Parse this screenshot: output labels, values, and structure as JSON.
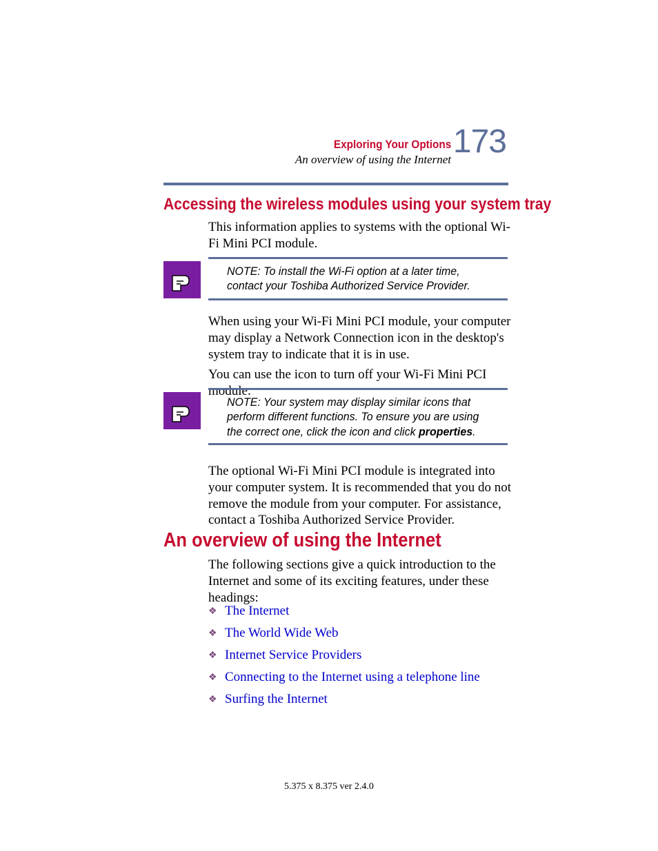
{
  "header": {
    "chapter": "Exploring Your Options",
    "section": "An overview of using the Internet",
    "page_number": "173"
  },
  "headings": {
    "h1": "Accessing the wireless modules using your system tray",
    "h2": "An overview of using the Internet"
  },
  "paragraphs": {
    "p1": "This information applies to systems with the optional Wi-Fi Mini PCI module.",
    "p2": "When using your Wi-Fi Mini PCI module, your computer may display a Network Connection icon in the desktop's system tray to indicate that it is in use.",
    "p3": "You can use the icon to turn off your Wi-Fi Mini PCI module.",
    "p4": "The optional Wi-Fi Mini PCI module is integrated into your computer system. It is recommended that you do not remove the module from your computer. For assistance, contact a Toshiba Authorized Service Provider.",
    "p5": "The following sections give a quick introduction to the Internet and some of its exciting features, under these headings:"
  },
  "notes": {
    "n1": "NOTE: To install the Wi-Fi option at a later time, contact your Toshiba Authorized Service Provider.",
    "n2_pre": "NOTE: Your system may display similar icons that perform different functions. To ensure you are using the correct one, click the icon and click ",
    "n2_bold": "properties",
    "n2_post": "."
  },
  "links": [
    "The Internet",
    "The World Wide Web",
    "Internet Service Providers",
    "Connecting to the Internet using a telephone line",
    "Surfing the Internet"
  ],
  "footer": "5.375 x 8.375 ver 2.4.0"
}
